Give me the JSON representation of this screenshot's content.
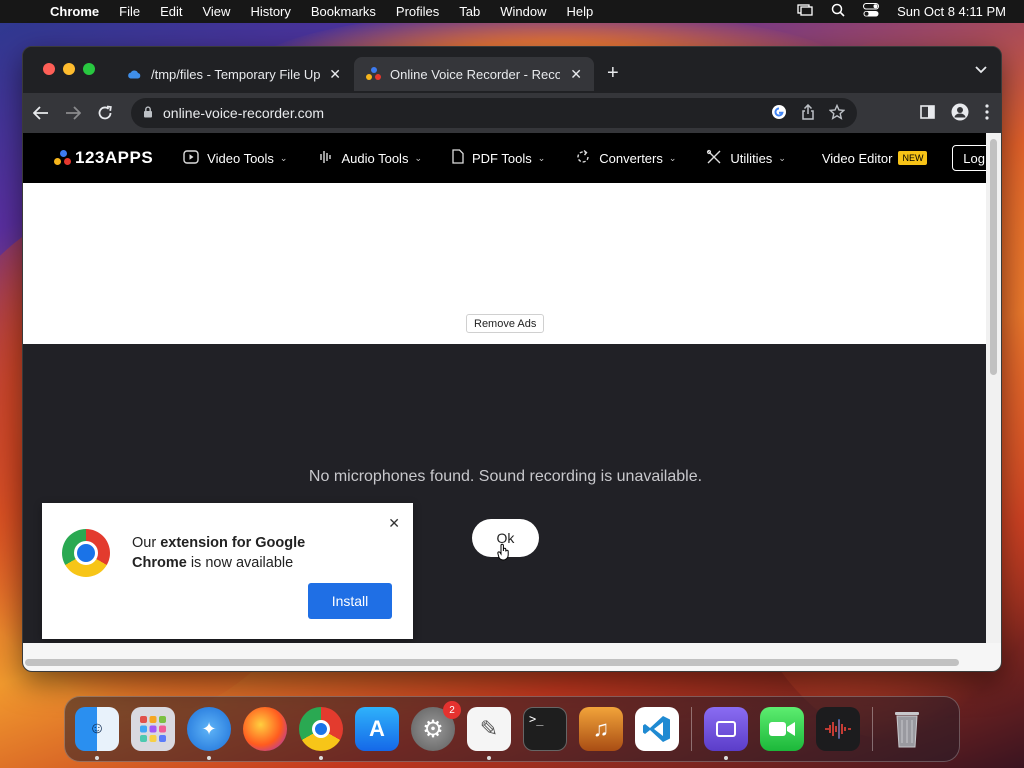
{
  "menubar": {
    "app_name": "Chrome",
    "items": [
      "File",
      "Edit",
      "View",
      "History",
      "Bookmarks",
      "Profiles",
      "Tab",
      "Window",
      "Help"
    ],
    "datetime": "Sun Oct 8  4:11 PM"
  },
  "browser": {
    "tabs": [
      {
        "title": "/tmp/files - Temporary File Up",
        "active": false
      },
      {
        "title": "Online Voice Recorder - Recor",
        "active": true
      }
    ],
    "url": "online-voice-recorder.com"
  },
  "site": {
    "logo": "123APPS",
    "nav": [
      {
        "label": "Video Tools",
        "icon": "play-square-icon"
      },
      {
        "label": "Audio Tools",
        "icon": "waveform-icon"
      },
      {
        "label": "PDF Tools",
        "icon": "document-icon"
      },
      {
        "label": "Converters",
        "icon": "refresh-icon"
      },
      {
        "label": "Utilities",
        "icon": "tools-icon"
      }
    ],
    "video_editor": "Video Editor",
    "new_badge": "NEW",
    "login": "Log"
  },
  "ads": {
    "remove_label": "Remove Ads"
  },
  "recorder": {
    "message": "No microphones found. Sound recording is unavailable.",
    "ok_label": "Ok"
  },
  "popup": {
    "text_before": "Our ",
    "text_bold": "extension for Google Chrome",
    "text_after": " is now available",
    "install_label": "Install"
  },
  "dock": {
    "apps": [
      "Finder",
      "Launchpad",
      "Safari",
      "Firefox",
      "Chrome",
      "App Store",
      "System Preferences",
      "TextEdit",
      "Terminal",
      "GarageBand",
      "VS Code",
      "Simulator",
      "FaceTime",
      "Voice Memos",
      "Trash"
    ],
    "system_prefs_badge": "2"
  },
  "colors": {
    "accent_blue": "#1f6fe5",
    "page_dark": "#212126",
    "new_badge": "#f7c317"
  }
}
